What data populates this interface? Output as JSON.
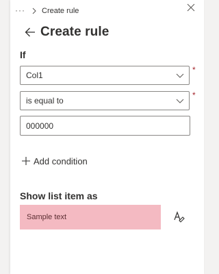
{
  "breadcrumb": {
    "overflow": "···",
    "current": "Create rule"
  },
  "header": {
    "title": "Create rule"
  },
  "rule": {
    "if_label": "If",
    "column": {
      "value": "Col1",
      "required_mark": "*"
    },
    "operator": {
      "value": "is equal to",
      "required_mark": "*"
    },
    "value_input": {
      "value": "000000"
    },
    "add_condition_label": "Add condition"
  },
  "format": {
    "label": "Show list item as",
    "sample_text": "Sample text",
    "sample_background": "#f4bac2"
  },
  "icons": {
    "close": "close-icon",
    "back": "arrow-left-icon",
    "chevron": "chevron-down-icon",
    "plus": "plus-icon",
    "format": "paint-format-icon"
  }
}
